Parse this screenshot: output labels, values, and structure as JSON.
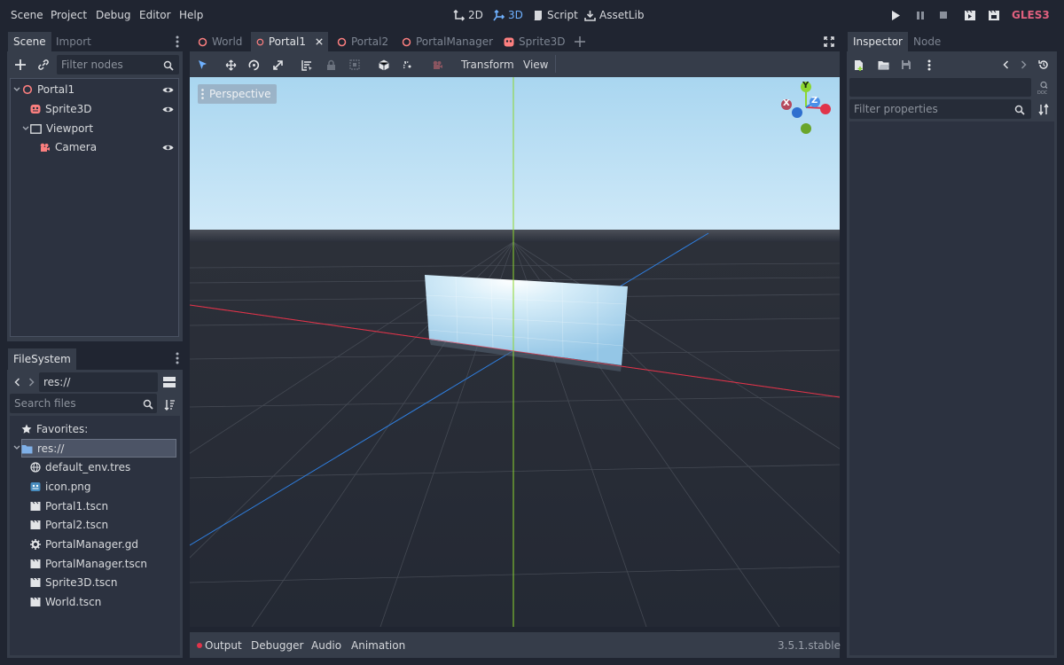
{
  "menu": {
    "items": [
      "Scene",
      "Project",
      "Debug",
      "Editor",
      "Help"
    ],
    "modes": [
      {
        "label": "2D",
        "icon": "2d-icon"
      },
      {
        "label": "3D",
        "icon": "3d-icon"
      },
      {
        "label": "Script",
        "icon": "script-icon"
      },
      {
        "label": "AssetLib",
        "icon": "assetlib-icon"
      }
    ],
    "active_mode": "3D",
    "renderer": "GLES3"
  },
  "scene_dock": {
    "tabs": [
      "Scene",
      "Import"
    ],
    "filter_placeholder": "Filter nodes",
    "nodes": [
      {
        "label": "Portal1",
        "icon": "spatial-node-icon",
        "visible": true
      },
      {
        "label": "Sprite3D",
        "icon": "sprite3d-icon",
        "visible": true
      },
      {
        "label": "Viewport",
        "icon": "viewport-icon",
        "visible": false
      },
      {
        "label": "Camera",
        "icon": "camera-icon",
        "visible": true
      }
    ]
  },
  "filesystem_dock": {
    "tab": "FileSystem",
    "path": "res://",
    "search_placeholder": "Search files",
    "favorites_label": "Favorites:",
    "root": "res://",
    "files": [
      {
        "name": "default_env.tres",
        "icon": "environment-icon"
      },
      {
        "name": "icon.png",
        "icon": "image-icon"
      },
      {
        "name": "Portal1.tscn",
        "icon": "scene-file-icon"
      },
      {
        "name": "Portal2.tscn",
        "icon": "scene-file-icon"
      },
      {
        "name": "PortalManager.gd",
        "icon": "gear-icon"
      },
      {
        "name": "PortalManager.tscn",
        "icon": "scene-file-icon"
      },
      {
        "name": "Sprite3D.tscn",
        "icon": "scene-file-icon"
      },
      {
        "name": "World.tscn",
        "icon": "scene-file-icon"
      }
    ]
  },
  "scene_tabs": [
    {
      "label": "World",
      "active": false
    },
    {
      "label": "Portal1",
      "active": true
    },
    {
      "label": "Portal2",
      "active": false
    },
    {
      "label": "PortalManager",
      "active": false
    },
    {
      "label": "Sprite3D",
      "active": false
    }
  ],
  "viewport_toolbar": {
    "transform_label": "Transform",
    "view_label": "View"
  },
  "viewport": {
    "perspective_label": "Perspective",
    "gizmo_labels": {
      "x": "X",
      "y": "Y",
      "z": "Z"
    }
  },
  "bottom_panel": {
    "items": [
      "Output",
      "Debugger",
      "Audio",
      "Animation"
    ],
    "version": "3.5.1.stable"
  },
  "inspector": {
    "tabs": [
      "Inspector",
      "Node"
    ],
    "filter_placeholder": "Filter properties"
  },
  "colors": {
    "accent": "#6fb1ff",
    "renderer": "#e0607e",
    "x_axis": "#e0344a",
    "y_axis": "#8cd630",
    "z_axis": "#2f7fe0"
  }
}
